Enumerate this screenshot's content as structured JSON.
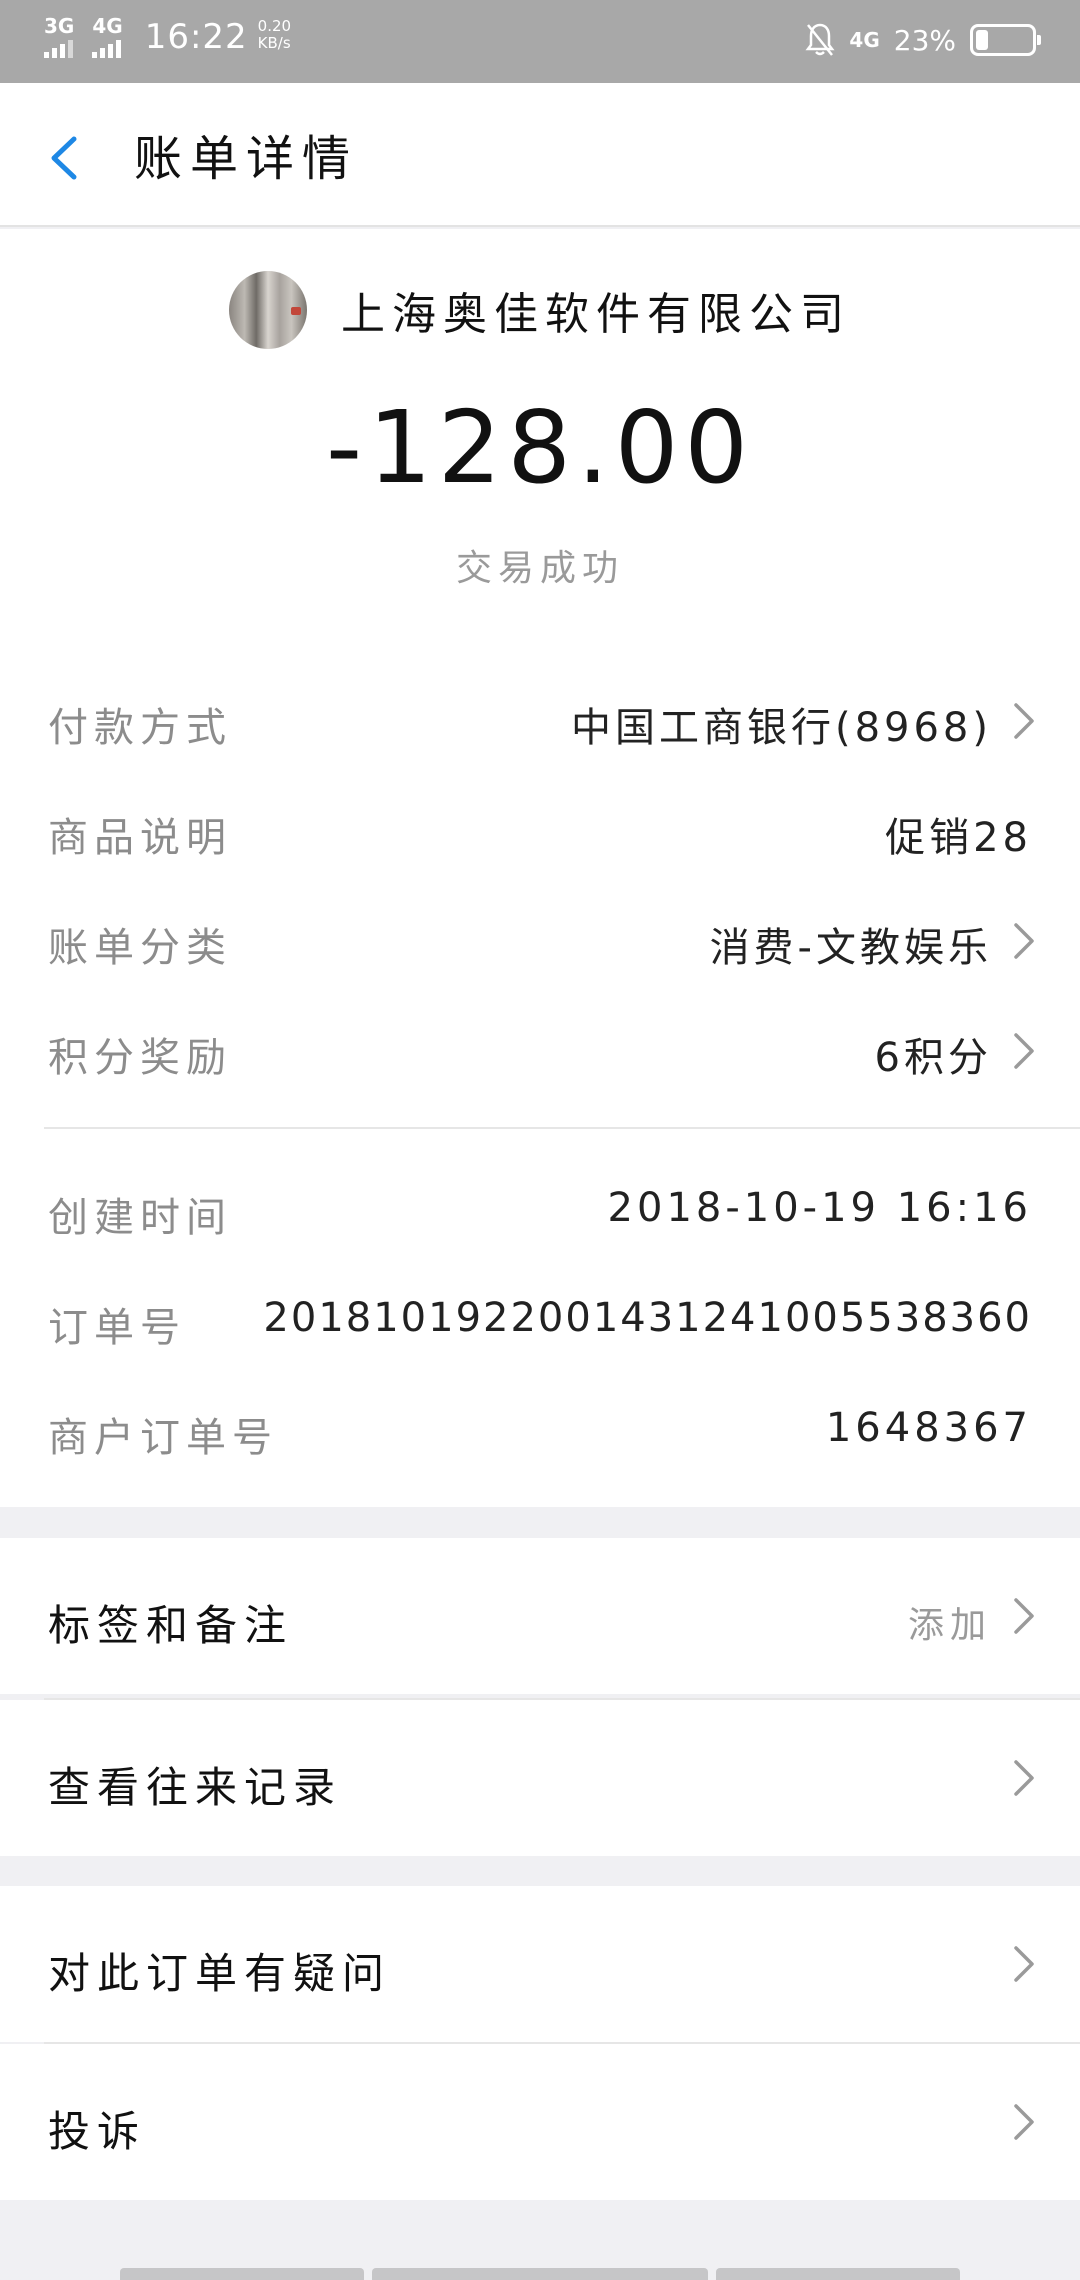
{
  "status_bar": {
    "net1": "3G",
    "net2": "4G",
    "time": "16:22",
    "speed_value": "0.20",
    "speed_unit": "KB/s",
    "net_right": "4G",
    "battery_pct": "23%",
    "battery_level": 0.23
  },
  "header": {
    "title": "账单详情"
  },
  "summary": {
    "merchant": "上海奥佳软件有限公司",
    "amount": "-128.00",
    "status": "交易成功"
  },
  "details": [
    {
      "label": "付款方式",
      "value": "中国工商银行(8968)"
    },
    {
      "label": "商品说明",
      "value": "促销28"
    },
    {
      "label": "账单分类",
      "value": "消费-文教娱乐"
    },
    {
      "label": "积分奖励",
      "value": "6积分"
    },
    {
      "label": "创建时间",
      "value": "2018-10-19 16:16"
    },
    {
      "label": "订单号",
      "value": "2018101922001431241005538360"
    },
    {
      "label": "商户订单号",
      "value": "1648367"
    }
  ],
  "actions": {
    "tags": {
      "label": "标签和备注",
      "hint": "添加"
    },
    "history": {
      "label": "查看往来记录"
    },
    "question": {
      "label": "对此订单有疑问"
    },
    "complaint": {
      "label": "投诉"
    }
  },
  "colors": {
    "accent": "#1e88e5",
    "status_bar": "#a8a8a8",
    "background": "#f0f0f3"
  }
}
